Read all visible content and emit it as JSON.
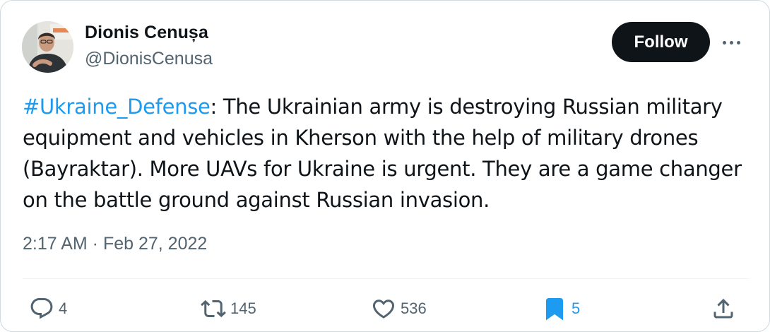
{
  "author": {
    "display_name": "Dionis Cenușa",
    "handle": "@DionisCenusa"
  },
  "header": {
    "follow_label": "Follow",
    "more_icon": "more-horizontal-icon"
  },
  "tweet": {
    "hashtag": "#Ukraine_Defense",
    "body": ": The Ukrainian army is destroying Russian military equipment and vehicles in Kherson with the help of military drones (Bayraktar). More UAVs for Ukraine is urgent. They are a game changer on the battle ground against Russian invasion.",
    "timestamp": "2:17 AM · Feb 27, 2022"
  },
  "actions": {
    "reply": {
      "icon": "reply-icon",
      "count": "4"
    },
    "retweet": {
      "icon": "retweet-icon",
      "count": "145"
    },
    "like": {
      "icon": "heart-icon",
      "count": "536"
    },
    "bookmark": {
      "icon": "bookmark-icon",
      "count": "5",
      "active": true
    },
    "share": {
      "icon": "share-icon"
    }
  },
  "colors": {
    "accent": "#1d9bf0",
    "text_primary": "#0f1419",
    "text_secondary": "#536471",
    "follow_bg": "#0f1419"
  }
}
